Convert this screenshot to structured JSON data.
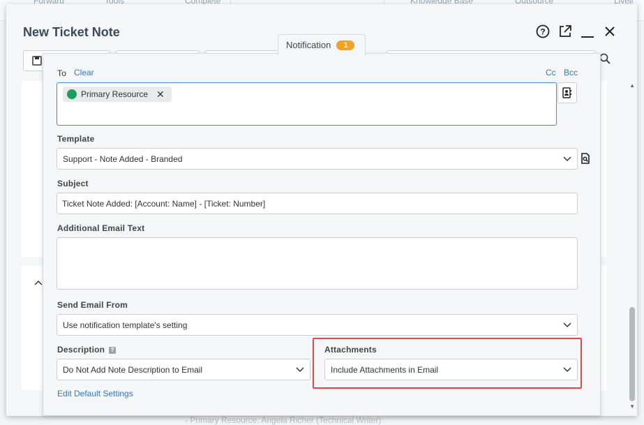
{
  "background": {
    "toolbar_items": [
      "Forward",
      "Tools",
      "Complete",
      "Knowledge Base",
      "Outsource",
      "Liveli"
    ],
    "footer_text": "- Primary Resource: Angela Richer (Technical Writer)"
  },
  "dialog": {
    "title": "New Ticket Note"
  },
  "notification": {
    "tab_label": "Notification",
    "badge_count": "1",
    "to_label": "To",
    "clear_link": "Clear",
    "cc_link": "Cc",
    "bcc_link": "Bcc",
    "recipient_chip": "Primary Resource",
    "template_label": "Template",
    "template_value": "Support - Note Added - Branded",
    "subject_label": "Subject",
    "subject_value": "Ticket Note Added: [Account: Name] - [Ticket: Number]",
    "additional_label": "Additional Email Text",
    "additional_value": "",
    "send_from_label": "Send Email From",
    "send_from_value": "Use notification template's setting",
    "description_label": "Description",
    "description_value": "Do Not Add Note Description to Email",
    "attachments_label": "Attachments",
    "attachments_value": "Include Attachments in Email",
    "edit_defaults_link": "Edit Default Settings"
  },
  "colors": {
    "accent": "#2b7bc4",
    "badge": "#f0a12a",
    "chip_dot": "#1e9e5c",
    "highlight": "#e0474c"
  }
}
